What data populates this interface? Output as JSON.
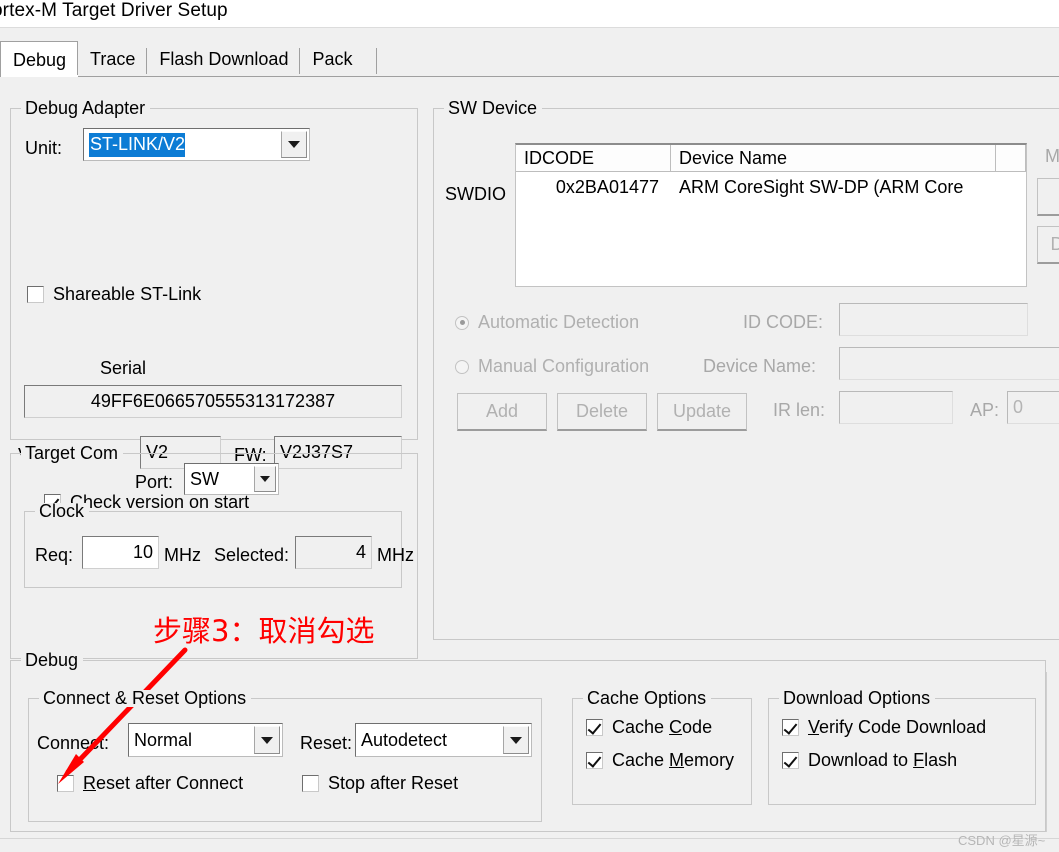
{
  "window": {
    "title": "ortex-M Target Driver Setup"
  },
  "tabs": [
    {
      "label": "Debug",
      "active": true
    },
    {
      "label": "Trace",
      "active": false
    },
    {
      "label": "Flash Download",
      "active": false
    },
    {
      "label": "Pack",
      "active": false
    }
  ],
  "debug_adapter": {
    "group_label": "Debug Adapter",
    "unit_label": "Unit:",
    "unit_value": "ST-LINK/V2",
    "shareable_label": "Shareable ST-Link",
    "shareable_checked": false,
    "serial_label": "Serial",
    "serial_value": "49FF6E066570555313172387",
    "version_label": "Version: HW:",
    "hw_value": "V2",
    "fw_label": "FW:",
    "fw_value": "V2J37S7",
    "check_version_label": "Check version on start",
    "check_version_checked": true
  },
  "target_com": {
    "group_label": "Target Com",
    "port_label": "Port:",
    "port_value": "SW",
    "clock_label": "Clock",
    "req_label": "Req:",
    "req_value": "10",
    "req_unit": "MHz",
    "selected_label": "Selected:",
    "selected_value": "4",
    "selected_unit": "MHz"
  },
  "sw_device": {
    "group_label": "SW Device",
    "swdio_label": "SWDIO",
    "columns": [
      "IDCODE",
      "Device Name",
      ""
    ],
    "rows": [
      {
        "idcode": "0x2BA01477",
        "device_name": "ARM CoreSight SW-DP (ARM Core"
      }
    ],
    "move_label": "M",
    "down_label": "D",
    "automatic_detection_label": "Automatic Detection",
    "automatic_detection_selected": true,
    "manual_configuration_label": "Manual Configuration",
    "manual_configuration_selected": false,
    "id_code_label": "ID CODE:",
    "id_code_value": "",
    "device_name_label": "Device Name:",
    "device_name_value": "",
    "ir_len_label": "IR len:",
    "ir_len_value": "",
    "ap_label": "AP:",
    "ap_value": "0",
    "add_label": "Add",
    "delete_label": "Delete",
    "update_label": "Update"
  },
  "debug_section": {
    "group_label": "Debug",
    "connect_reset": {
      "group_label": "Connect & Reset Options",
      "connect_label": "Connect:",
      "connect_value": "Normal",
      "reset_label": "Reset:",
      "reset_value": "Autodetect",
      "reset_after_connect_label_pre": "",
      "reset_after_connect_accel": "R",
      "reset_after_connect_label_post": "eset after Connect",
      "reset_after_connect_checked": false,
      "stop_after_reset_label": "Stop after Reset",
      "stop_after_reset_checked": false
    },
    "cache_options": {
      "group_label": "Cache Options",
      "cache_code_pre": "Cache ",
      "cache_code_accel": "C",
      "cache_code_post": "ode",
      "cache_code_checked": true,
      "cache_memory_pre": "Cache ",
      "cache_memory_accel": "M",
      "cache_memory_post": "emory",
      "cache_memory_checked": true
    },
    "download_options": {
      "group_label": "Download Options",
      "verify_pre": "",
      "verify_accel": "V",
      "verify_post": "erify Code Download",
      "verify_checked": true,
      "flash_pre": "Download to ",
      "flash_accel": "F",
      "flash_post": "lash",
      "flash_checked": true
    }
  },
  "annotation": {
    "text": "步骤3：取消勾选",
    "color": "#ff0000"
  },
  "watermark": {
    "text": "CSDN @星源~"
  }
}
